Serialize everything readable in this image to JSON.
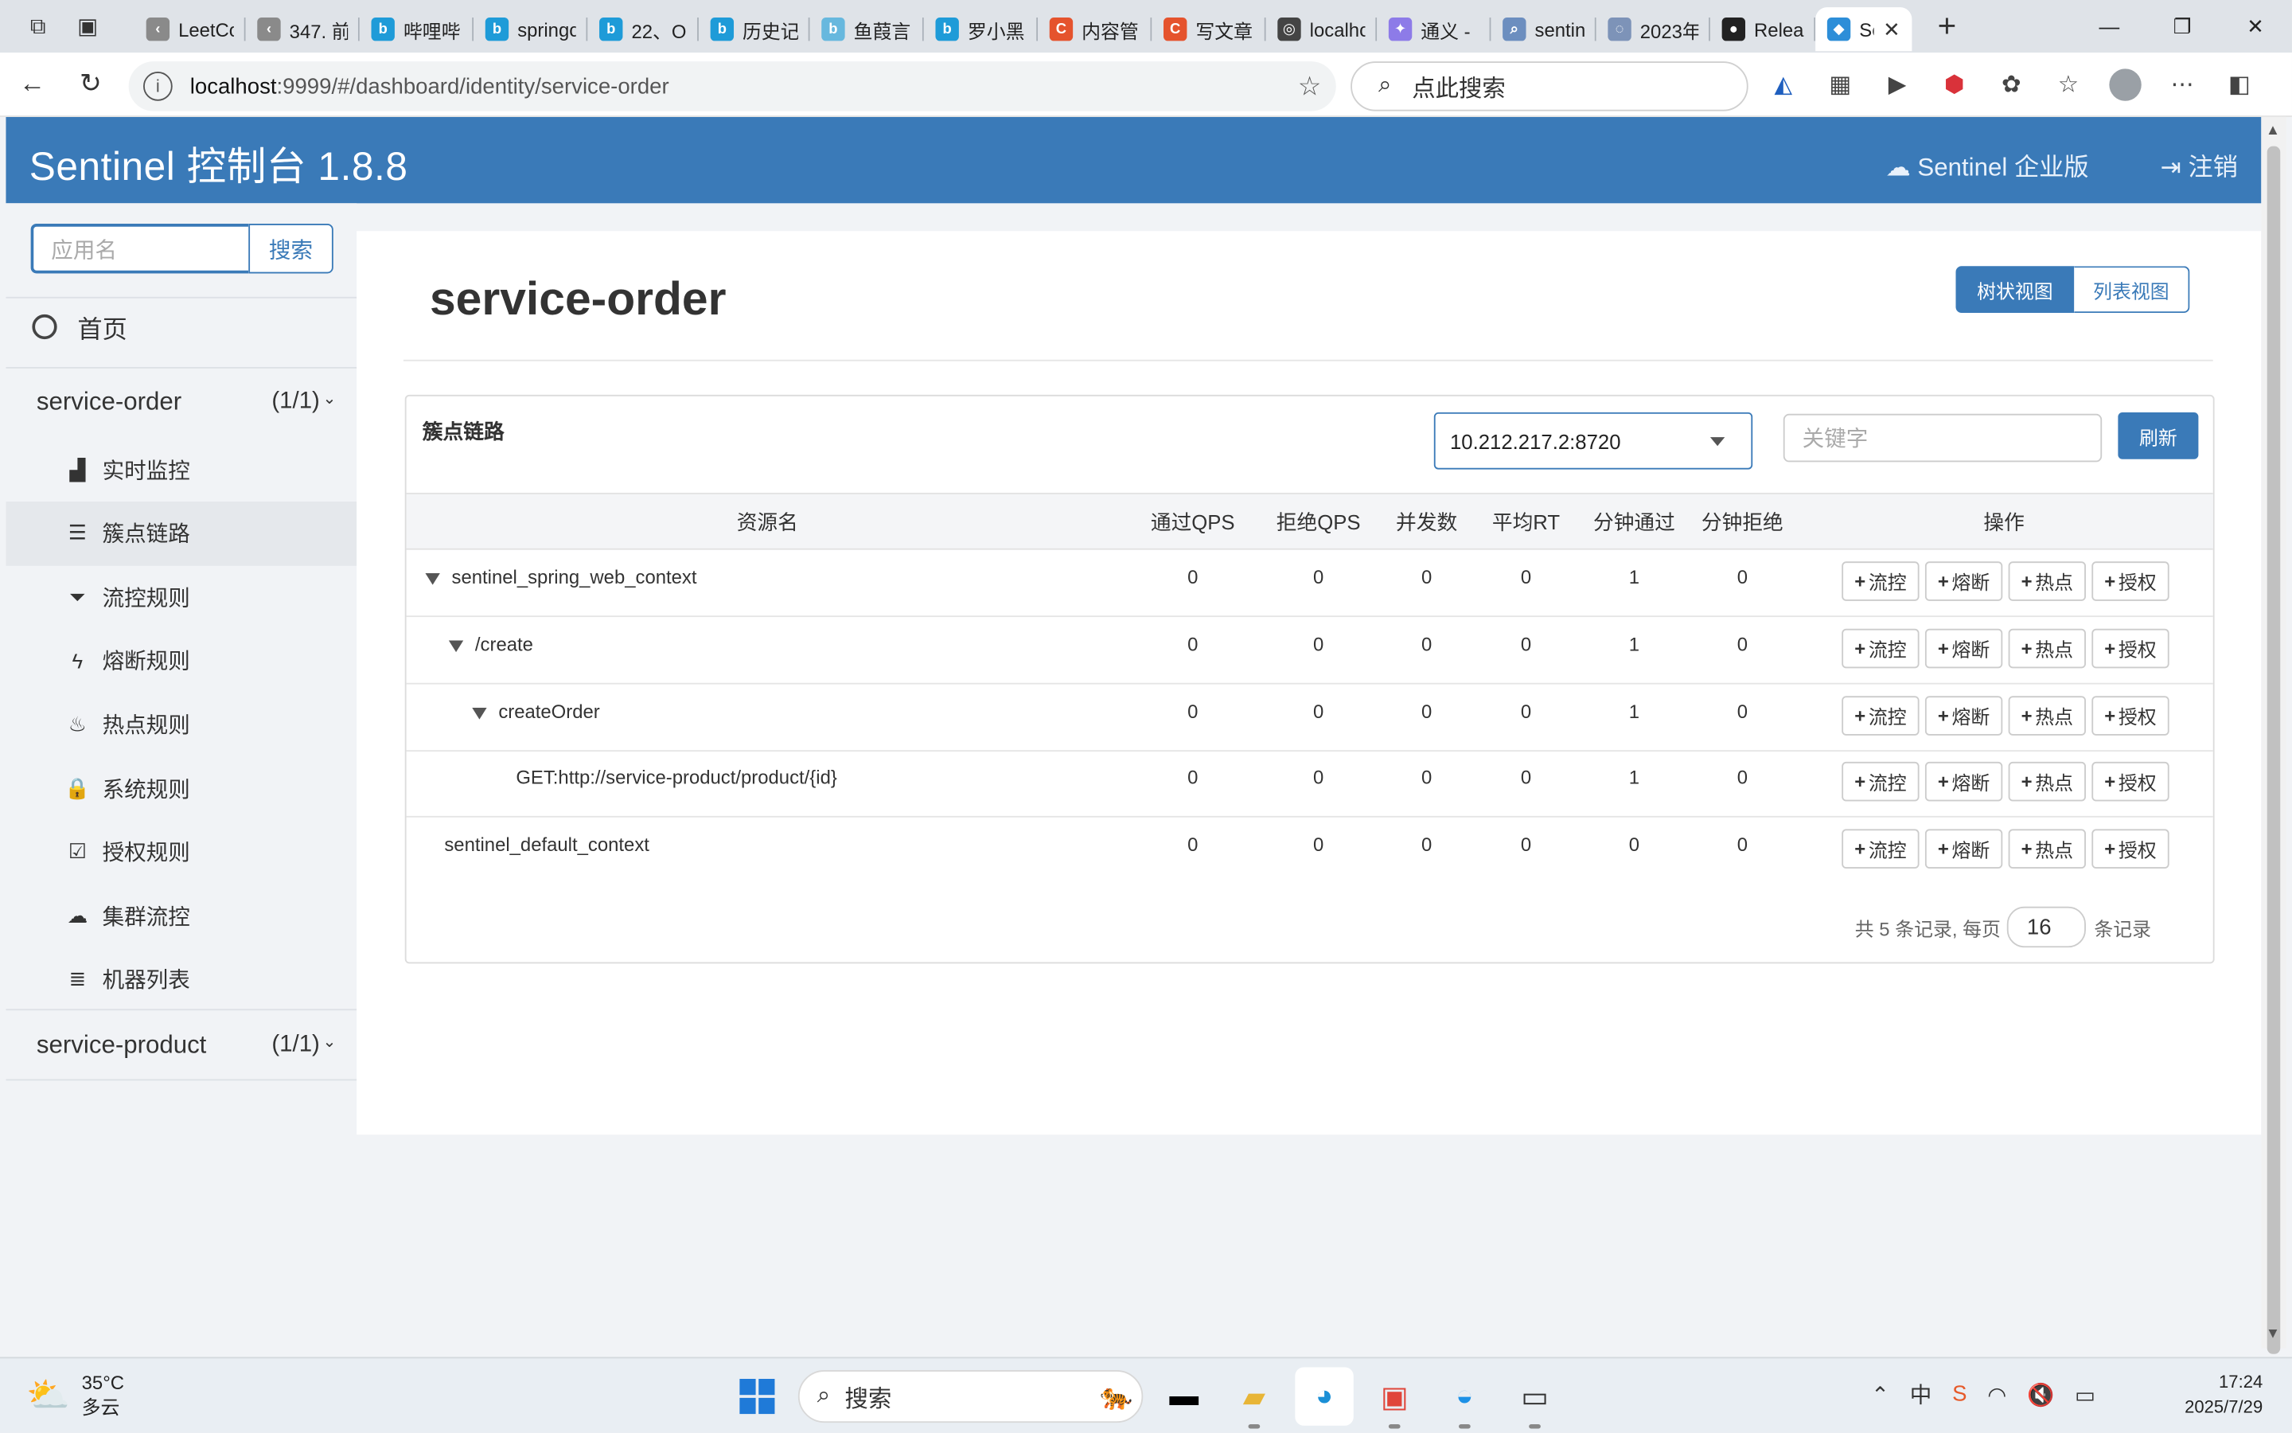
{
  "browser": {
    "tabs": [
      {
        "title": "LeetCo",
        "fav_color": "#8a8a8a",
        "fav_glyph": "‹"
      },
      {
        "title": "347. 前",
        "fav_color": "#8a8a8a",
        "fav_glyph": "‹"
      },
      {
        "title": "哔哩哔",
        "fav_color": "#1e9bd8",
        "fav_glyph": "b"
      },
      {
        "title": "springc",
        "fav_color": "#1e9bd8",
        "fav_glyph": "b"
      },
      {
        "title": "22、O",
        "fav_color": "#1e9bd8",
        "fav_glyph": "b"
      },
      {
        "title": "历史记",
        "fav_color": "#1e9bd8",
        "fav_glyph": "b"
      },
      {
        "title": "鱼葭言",
        "fav_color": "#67b8de",
        "fav_glyph": "b"
      },
      {
        "title": "罗小黑",
        "fav_color": "#1e9bd8",
        "fav_glyph": "b"
      },
      {
        "title": "内容管",
        "fav_color": "#e5532d",
        "fav_glyph": "C"
      },
      {
        "title": "写文章",
        "fav_color": "#e5532d",
        "fav_glyph": "C"
      },
      {
        "title": "localhc",
        "fav_color": "#444444",
        "fav_glyph": "◎"
      },
      {
        "title": "通义 -",
        "fav_color": "#8d7be8",
        "fav_glyph": "✦"
      },
      {
        "title": "sentine",
        "fav_color": "#6c8ebf",
        "fav_glyph": "⌕"
      },
      {
        "title": "2023年",
        "fav_color": "#7d93b8",
        "fav_glyph": "◌"
      },
      {
        "title": "Release",
        "fav_color": "#222222",
        "fav_glyph": "●"
      },
      {
        "title": "Se",
        "fav_color": "#2d8ed8",
        "fav_glyph": "◆",
        "active": true
      }
    ],
    "url_host": "localhost",
    "url_path": ":9999/#/dashboard/identity/service-order",
    "search_placeholder": "点此搜索"
  },
  "header": {
    "brand": "Sentinel 控制台 1.8.8",
    "enterprise": "Sentinel 企业版",
    "logout": "注销"
  },
  "sidebar": {
    "app_search_placeholder": "应用名",
    "app_search_button": "搜索",
    "home": "首页",
    "apps": [
      {
        "name": "service-order",
        "count": "(1/1)"
      },
      {
        "name": "service-product",
        "count": "(1/1)"
      }
    ],
    "menu": [
      {
        "label": "实时监控",
        "icon": "bar-chart-icon"
      },
      {
        "label": "簇点链路",
        "icon": "list-icon",
        "active": true
      },
      {
        "label": "流控规则",
        "icon": "filter-icon"
      },
      {
        "label": "熔断规则",
        "icon": "bolt-icon"
      },
      {
        "label": "热点规则",
        "icon": "fire-icon"
      },
      {
        "label": "系统规则",
        "icon": "lock-icon"
      },
      {
        "label": "授权规则",
        "icon": "check-icon"
      },
      {
        "label": "集群流控",
        "icon": "cloud-icon"
      },
      {
        "label": "机器列表",
        "icon": "th-list-icon"
      }
    ]
  },
  "main": {
    "title": "service-order",
    "view_tree": "树状视图",
    "view_list": "列表视图",
    "card_title": "簇点链路",
    "machine": "10.212.217.2:8720",
    "keyword_placeholder": "关键字",
    "refresh": "刷新",
    "columns": [
      "资源名",
      "通过QPS",
      "拒绝QPS",
      "并发数",
      "平均RT",
      "分钟通过",
      "分钟拒绝",
      "操作"
    ],
    "rows": [
      {
        "name": "sentinel_spring_web_context",
        "expand": true,
        "level": 0,
        "values": [
          "0",
          "0",
          "0",
          "0",
          "1",
          "0"
        ]
      },
      {
        "name": "/create",
        "expand": true,
        "level": 1,
        "values": [
          "0",
          "0",
          "0",
          "0",
          "1",
          "0"
        ]
      },
      {
        "name": "createOrder",
        "expand": true,
        "level": 2,
        "values": [
          "0",
          "0",
          "0",
          "0",
          "1",
          "0"
        ]
      },
      {
        "name": "GET:http://service-product/product/{id}",
        "expand": false,
        "level": 3,
        "values": [
          "0",
          "0",
          "0",
          "0",
          "1",
          "0"
        ]
      },
      {
        "name": "sentinel_default_context",
        "expand": false,
        "level": 0,
        "values": [
          "0",
          "0",
          "0",
          "0",
          "0",
          "0"
        ]
      }
    ],
    "ops": [
      "流控",
      "熔断",
      "热点",
      "授权"
    ],
    "pager_prefix": "共 5 条记录, 每页",
    "page_size": "16",
    "pager_suffix": "条记录"
  },
  "taskbar": {
    "temp": "35°C",
    "weather": "多云",
    "search": "搜索",
    "time": "17:24",
    "date": "2025/7/29"
  },
  "colors": {
    "accent": "#3a7ab8",
    "header_bg": "#3a7ab8"
  }
}
